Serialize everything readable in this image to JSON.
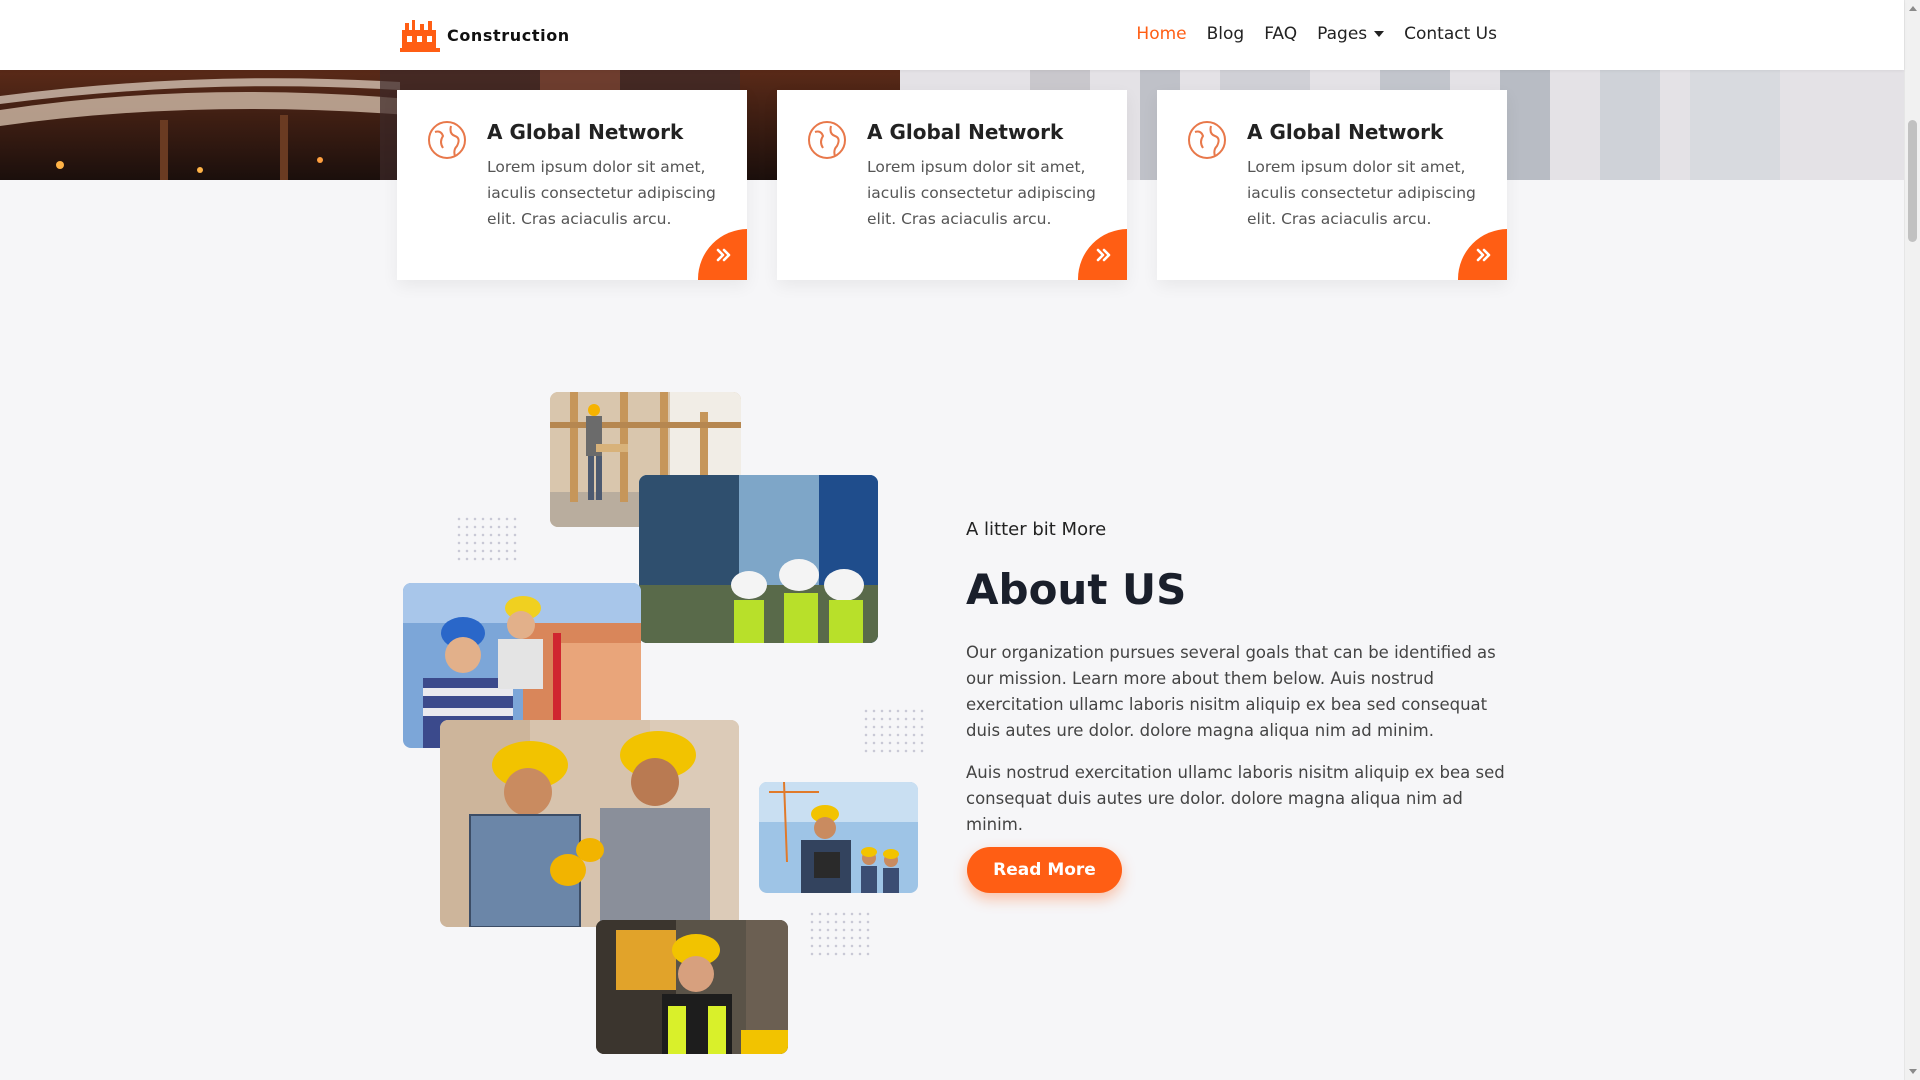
{
  "brand": {
    "name": "Construction",
    "accent": "#ff5e14"
  },
  "nav": {
    "items": [
      {
        "label": "Home",
        "active": true
      },
      {
        "label": "Blog",
        "active": false
      },
      {
        "label": "FAQ",
        "active": false
      },
      {
        "label": "Pages",
        "active": false,
        "dropdown": true
      },
      {
        "label": "Contact Us",
        "active": false
      }
    ]
  },
  "features": {
    "cards": [
      {
        "icon": "globe-icon",
        "title": "A Global Network",
        "text": "Lorem ipsum dolor sit amet, iaculis consectetur adipiscing elit. Cras aciaculis arcu.",
        "arrow_icon": "double-chevron-right-icon"
      },
      {
        "icon": "globe-icon",
        "title": "A Global Network",
        "text": "Lorem ipsum dolor sit amet, iaculis consectetur adipiscing elit. Cras aciaculis arcu.",
        "arrow_icon": "double-chevron-right-icon"
      },
      {
        "icon": "globe-icon",
        "title": "A Global Network",
        "text": "Lorem ipsum dolor sit amet, iaculis consectetur adipiscing elit. Cras aciaculis arcu.",
        "arrow_icon": "double-chevron-right-icon"
      }
    ]
  },
  "about": {
    "eyebrow": "A litter bit More",
    "title": "About US",
    "paragraph_1": "Our organization pursues several goals that can be identified as our mission. Learn more about them below. Auis nostrud exercitation ullamc laboris nisitm aliquip ex bea sed consequat duis autes ure dolor. dolore magna aliqua nim ad minim.",
    "paragraph_2": "Auis nostrud exercitation ullamc laboris nisitm aliquip ex bea sed consequat duis autes ure dolor. dolore magna aliqua nim ad minim.",
    "button_label": "Read More"
  }
}
